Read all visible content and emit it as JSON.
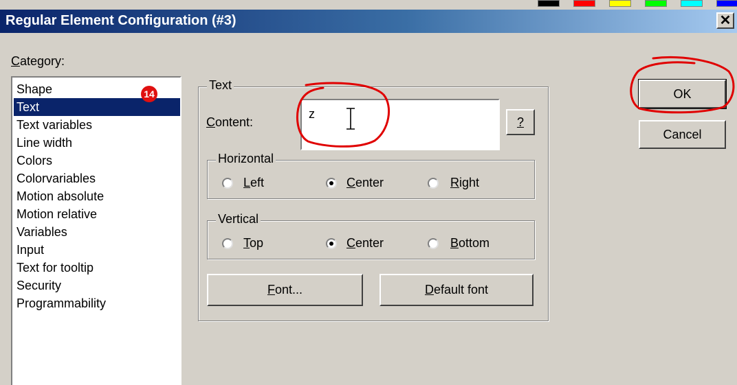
{
  "window": {
    "title": "Regular Element Configuration (#3)",
    "close_glyph": "✕",
    "palette_colors": [
      "#000000",
      "#ff0000",
      "#ffff00",
      "#00ff00",
      "#00ffff",
      "#0000ff"
    ]
  },
  "category": {
    "label": "Category:",
    "items": [
      "Shape",
      "Text",
      "Text variables",
      "Line width",
      "Colors",
      "Colorvariables",
      "Motion absolute",
      "Motion relative",
      "Variables",
      "Input",
      "Text for tooltip",
      "Security",
      "Programmability"
    ],
    "selected": "Text",
    "badge": "14"
  },
  "text_group": {
    "legend": "Text",
    "content_label": "Content:",
    "content_value": "z",
    "help_button": "?",
    "horizontal": {
      "legend": "Horizontal",
      "options": [
        "Left",
        "Center",
        "Right"
      ],
      "selected": "Center"
    },
    "vertical": {
      "legend": "Vertical",
      "options": [
        "Top",
        "Center",
        "Bottom"
      ],
      "selected": "Center"
    },
    "font_button": "Font...",
    "default_font_button": "Default font"
  },
  "buttons": {
    "ok": "OK",
    "cancel": "Cancel"
  },
  "annotation_color": "#e00000"
}
